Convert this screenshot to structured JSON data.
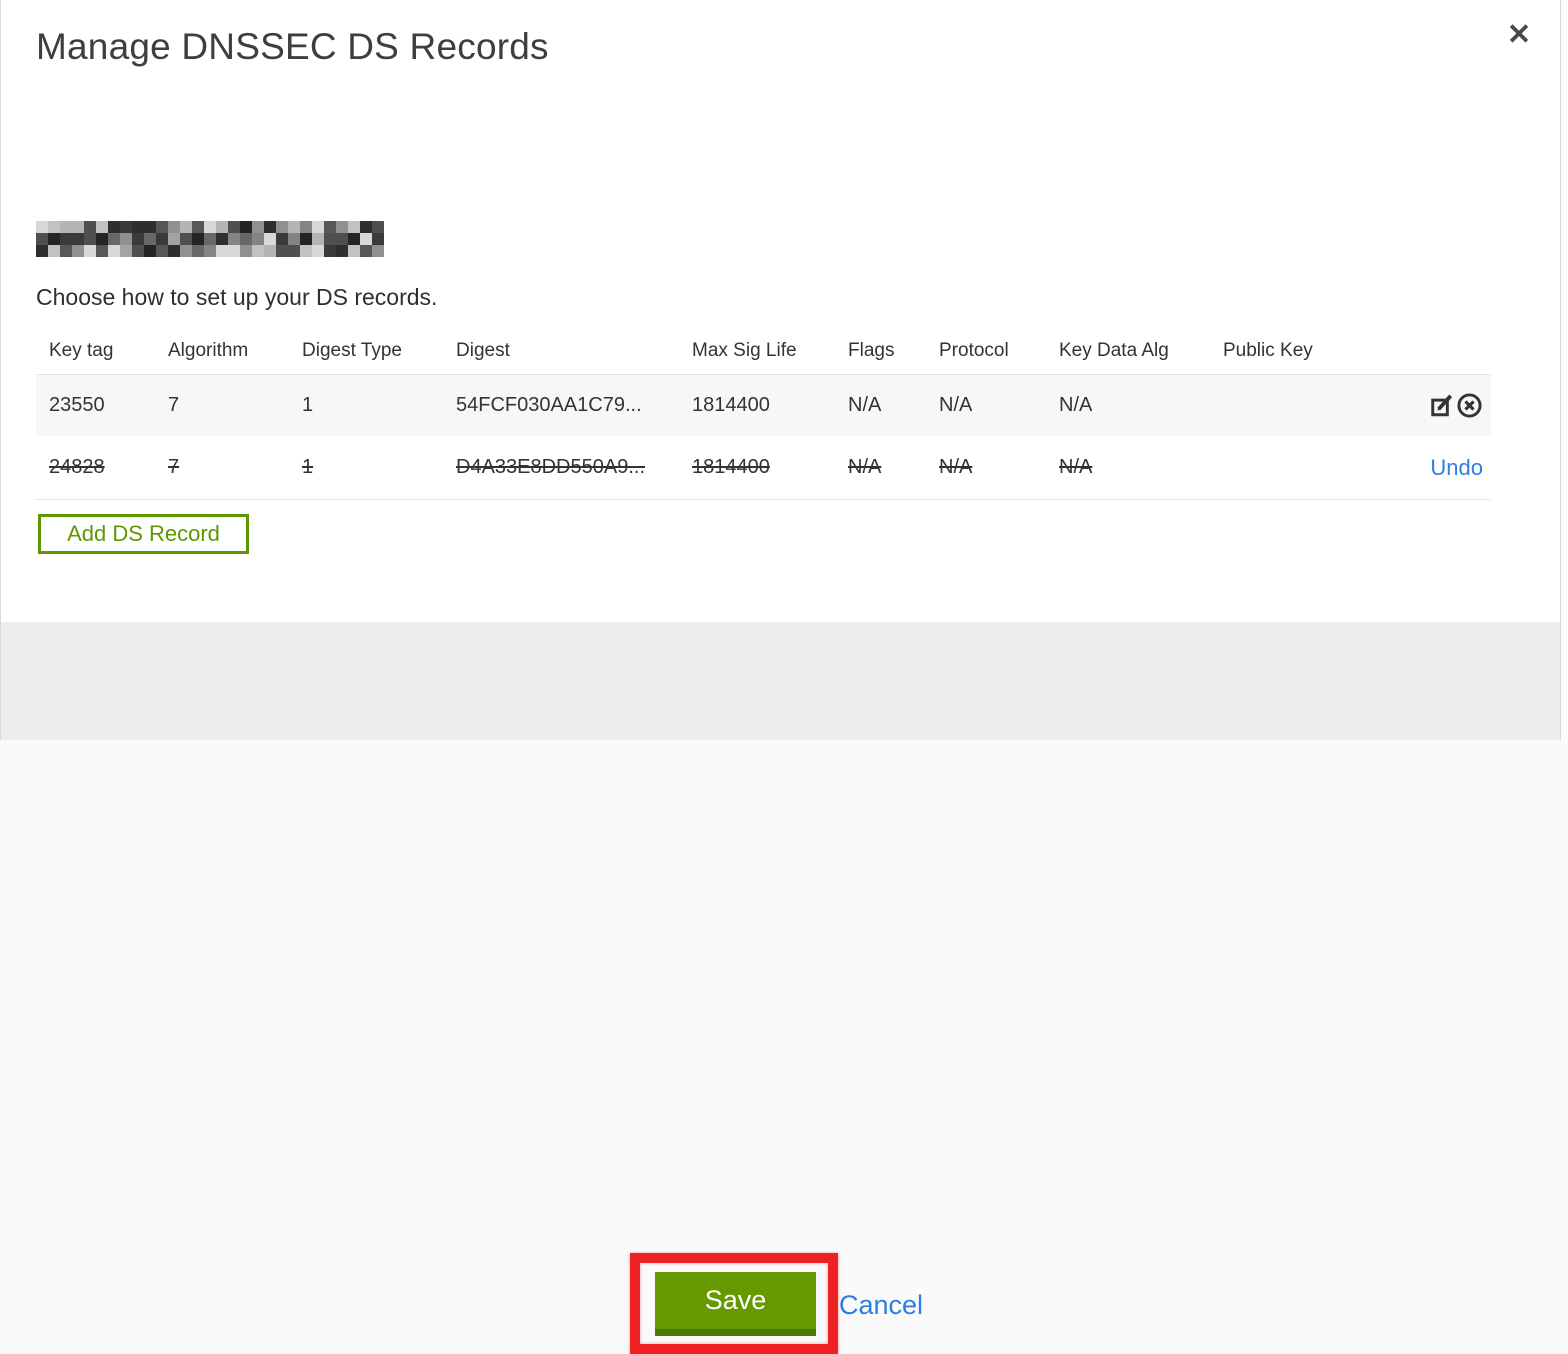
{
  "dialog": {
    "title": "Manage DNSSEC DS Records",
    "close_glyph": "✕",
    "subtitle": "Choose how to set up your DS records.",
    "domain_redacted": true,
    "table": {
      "columns": [
        "Key tag",
        "Algorithm",
        "Digest Type",
        "Digest",
        "Max Sig Life",
        "Flags",
        "Protocol",
        "Key Data Alg",
        "Public Key"
      ],
      "rows": [
        {
          "key_tag": "23550",
          "algorithm": "7",
          "digest_type": "1",
          "digest": "54FCF030AA1C79...",
          "max_sig_life": "1814400",
          "flags": "N/A",
          "protocol": "N/A",
          "key_data_alg": "N/A",
          "public_key": "",
          "state": "normal",
          "actions": [
            "edit-icon",
            "delete-icon"
          ]
        },
        {
          "key_tag": "24828",
          "algorithm": "7",
          "digest_type": "1",
          "digest": "D4A33E8DD550A9...",
          "max_sig_life": "1814400",
          "flags": "N/A",
          "protocol": "N/A",
          "key_data_alg": "N/A",
          "public_key": "",
          "state": "deleted",
          "undo_label": "Undo"
        }
      ]
    },
    "add_button_label": "Add DS Record",
    "footer": {
      "save_label": "Save",
      "cancel_label": "Cancel"
    }
  },
  "annotation": {
    "type": "highlight-box",
    "target": "save-button"
  },
  "colors": {
    "green": "#669900",
    "green_dark": "#4b7a00",
    "green_outline": "#5f9702",
    "link_blue": "#2d7ede",
    "annotation_red": "#ee2223",
    "row_gray": "#f7f7f7",
    "footer_gray": "#ededed"
  }
}
